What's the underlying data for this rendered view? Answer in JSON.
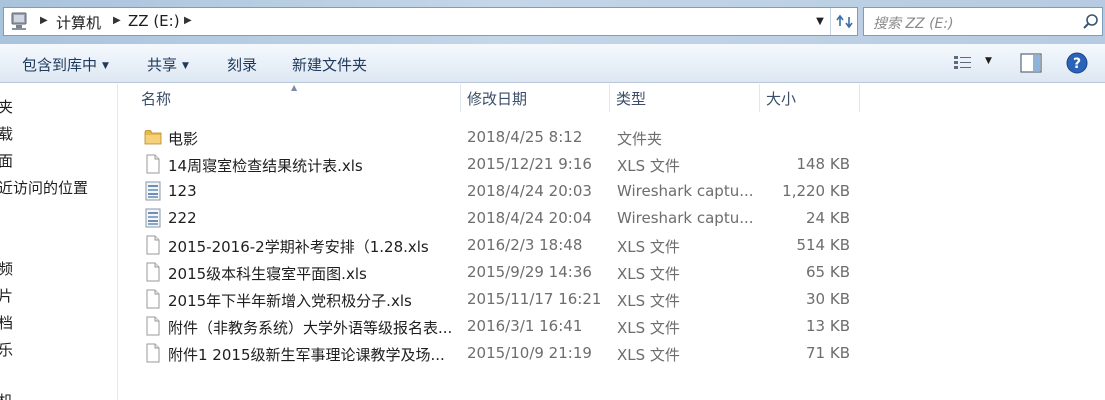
{
  "address_bar": {
    "breadcrumbs": [
      "计算机",
      "ZZ (E:)"
    ]
  },
  "search": {
    "placeholder": "搜索 ZZ (E:)"
  },
  "toolbar": {
    "include_library": "包含到库中",
    "share": "共享",
    "burn": "刻录",
    "new_folder": "新建文件夹"
  },
  "nav_pane": {
    "items": [
      "夹",
      "载",
      "面",
      "近访问的位置",
      "频",
      "片",
      "档",
      "乐",
      "机"
    ]
  },
  "columns": {
    "name": "名称",
    "date": "修改日期",
    "type": "类型",
    "size": "大小"
  },
  "files": [
    {
      "name": "电影",
      "date": "2018/4/25 8:12",
      "type": "文件夹",
      "size": "",
      "icon": "folder-icon"
    },
    {
      "name": "14周寝室检查结果统计表.xls",
      "date": "2015/12/21 9:16",
      "type": "XLS 文件",
      "size": "148 KB",
      "icon": "file-icon"
    },
    {
      "name": "123",
      "date": "2018/4/24 20:03",
      "type": "Wireshark captu...",
      "size": "1,220 KB",
      "icon": "capture-file-icon"
    },
    {
      "name": "222",
      "date": "2018/4/24 20:04",
      "type": "Wireshark captu...",
      "size": "24 KB",
      "icon": "capture-file-icon"
    },
    {
      "name": "2015-2016-2学期补考安排（1.28.xls",
      "date": "2016/2/3 18:48",
      "type": "XLS 文件",
      "size": "514 KB",
      "icon": "file-icon"
    },
    {
      "name": "2015级本科生寝室平面图.xls",
      "date": "2015/9/29 14:36",
      "type": "XLS 文件",
      "size": "65 KB",
      "icon": "file-icon"
    },
    {
      "name": "2015年下半年新增入党积极分子.xls",
      "date": "2015/11/17 16:21",
      "type": "XLS 文件",
      "size": "30 KB",
      "icon": "file-icon"
    },
    {
      "name": "附件（非教务系统）大学外语等级报名表...",
      "date": "2016/3/1 16:41",
      "type": "XLS 文件",
      "size": "13 KB",
      "icon": "file-icon"
    },
    {
      "name": "附件1 2015级新生军事理论课教学及场...",
      "date": "2015/10/9 21:19",
      "type": "XLS 文件",
      "size": "71 KB",
      "icon": "file-icon"
    }
  ]
}
